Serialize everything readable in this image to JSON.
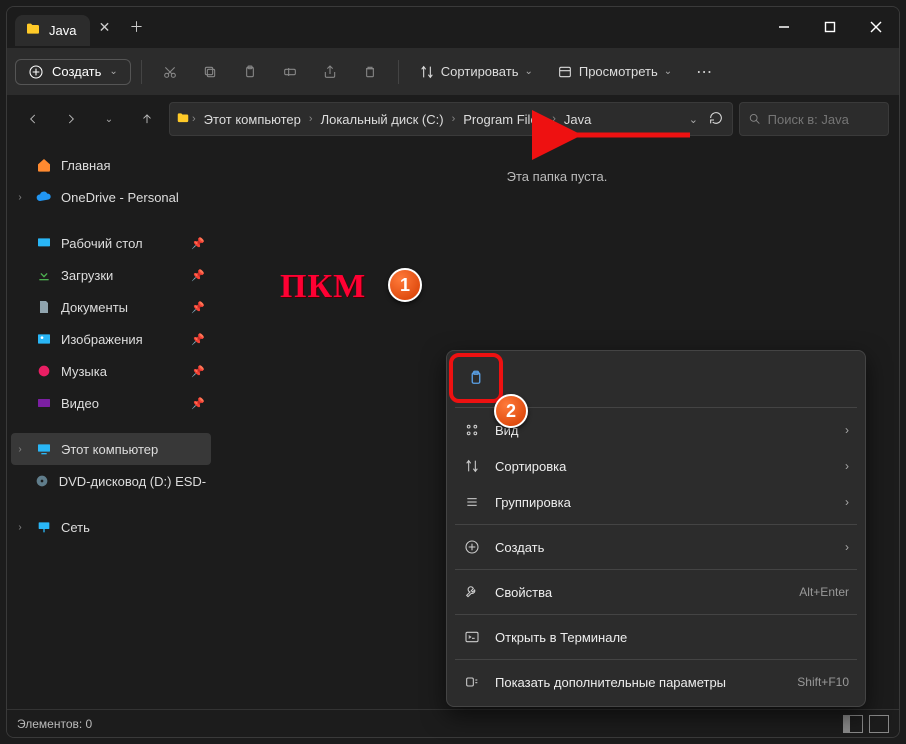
{
  "titlebar": {
    "tab_title": "Java"
  },
  "toolbar": {
    "create": "Создать",
    "sort": "Сортировать",
    "view": "Просмотреть"
  },
  "breadcrumb": {
    "items": [
      "Этот компьютер",
      "Локальный диск (C:)",
      "Program Files",
      "Java"
    ]
  },
  "search": {
    "placeholder": "Поиск в: Java"
  },
  "sidebar": {
    "home": "Главная",
    "onedrive": "OneDrive - Personal",
    "desktop": "Рабочий стол",
    "downloads": "Загрузки",
    "documents": "Документы",
    "pictures": "Изображения",
    "music": "Музыка",
    "videos": "Видео",
    "thispc": "Этот компьютер",
    "dvd": "DVD-дисковод (D:) ESD-IS",
    "network": "Сеть"
  },
  "content": {
    "empty": "Эта папка пуста."
  },
  "context_menu": {
    "view": "Вид",
    "sort": "Сортировка",
    "group": "Группировка",
    "new": "Создать",
    "properties": "Свойства",
    "properties_shortcut": "Alt+Enter",
    "terminal": "Открыть в Терминале",
    "more": "Показать дополнительные параметры",
    "more_shortcut": "Shift+F10"
  },
  "status": {
    "items": "Элементов: 0"
  },
  "annotations": {
    "label": "ПКМ",
    "badge1": "1",
    "badge2": "2"
  }
}
